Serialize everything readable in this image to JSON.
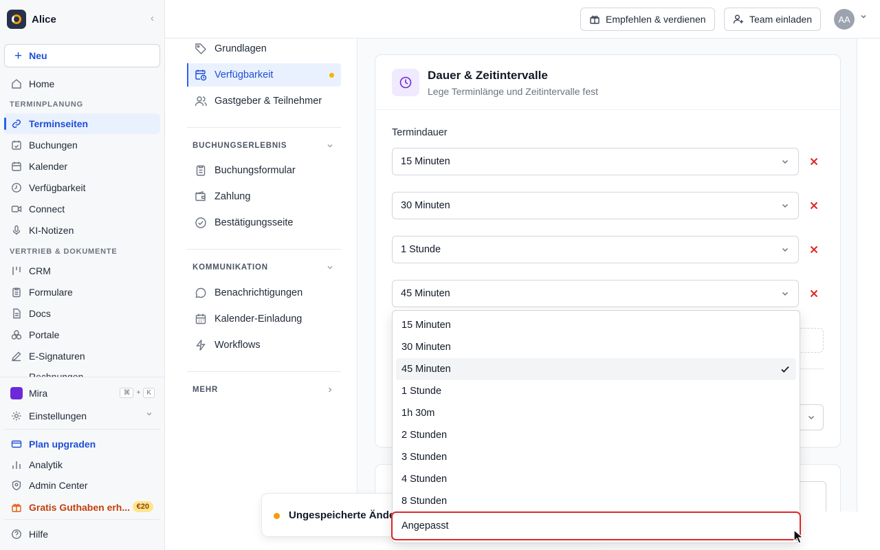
{
  "workspace": {
    "name": "Alice"
  },
  "sidebar": {
    "new_label": "Neu",
    "home": "Home",
    "section_scheduling": "TERMINPLANUNG",
    "scheduling_items": [
      "Terminseiten",
      "Buchungen",
      "Kalender",
      "Verfügbarkeit",
      "Connect",
      "KI-Notizen"
    ],
    "section_sales": "VERTRIEB & DOKUMENTE",
    "sales_items": [
      "CRM",
      "Formulare",
      "Docs",
      "Portale",
      "E-Signaturen",
      "Rechnungen"
    ],
    "mira": {
      "label": "Mira",
      "shortcut": [
        "⌘",
        "+",
        "K"
      ]
    },
    "settings": "Einstellungen",
    "upgrade": "Plan upgraden",
    "analytics": "Analytik",
    "admin": "Admin Center",
    "credit": {
      "label": "Gratis Guthaben erh...",
      "badge": "€20"
    },
    "help": "Hilfe"
  },
  "topbar": {
    "refer_label": "Empfehlen & verdienen",
    "invite_label": "Team einladen",
    "avatar_initials": "AA"
  },
  "subnav": {
    "items_top": [
      "Grundlagen",
      "Verfügbarkeit",
      "Gastgeber & Teilnehmer"
    ],
    "section_booking": "BUCHUNGSERLEBNIS",
    "booking_items": [
      "Buchungsformular",
      "Zahlung",
      "Bestätigungsseite"
    ],
    "section_comm": "KOMMUNIKATION",
    "comm_items": [
      "Benachrichtigungen",
      "Kalender-Einladung",
      "Workflows"
    ],
    "section_more": "MEHR"
  },
  "card": {
    "title": "Dauer & Zeitintervalle",
    "subtitle": "Lege Terminlänge und Zeitintervalle fest",
    "field_label": "Termindauer",
    "durations": [
      "15 Minuten",
      "30 Minuten",
      "1 Stunde",
      "45 Minuten"
    ]
  },
  "dropdown": {
    "options": [
      "15 Minuten",
      "30 Minuten",
      "45 Minuten",
      "1 Stunde",
      "1h 30m",
      "2 Stunden",
      "3 Stunden",
      "4 Stunden",
      "8 Stunden",
      "Angepasst"
    ],
    "selected": "45 Minuten",
    "highlighted": "Angepasst"
  },
  "toast": {
    "text": "Ungespeicherte Änderungen"
  },
  "colors": {
    "accent": "#1d4ed8",
    "danger": "#dc2626",
    "warning": "#f59e0b"
  }
}
